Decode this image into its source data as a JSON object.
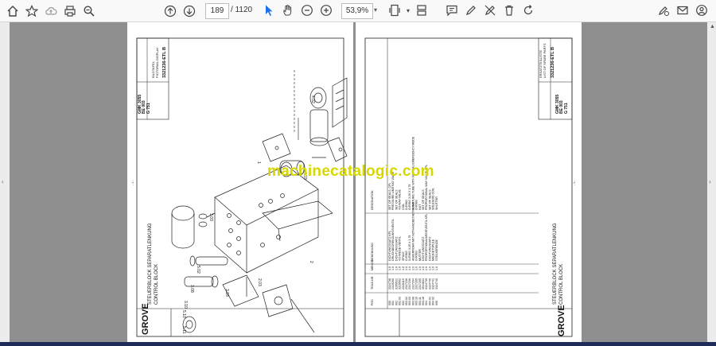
{
  "toolbar": {
    "page_current": "189",
    "page_total": "/ 1120",
    "zoom": "53,9%"
  },
  "watermark": "machinecatalogic.com",
  "left_page": {
    "brand": "GROVE",
    "title_de": "STEUERBLOCK SEPARATLENKUNG",
    "title_en": "CONTROL BLOCK",
    "model": "GMK 3055",
    "section": "BE 003",
    "sheet": "G 751",
    "drawing_no": "3321236-ETL B",
    "subtitle_de": "BILDTAFEL",
    "subtitle_en": "PICTORIAL DISPLAY",
    "page_marker": "- 1 -",
    "callouts": [
      "4.02",
      "4.03",
      "1",
      "3.03",
      "5.02",
      "3.08",
      "3.10",
      "5.10",
      "5.11",
      "3.18",
      "2.03",
      "2"
    ]
  },
  "right_page": {
    "brand": "GROVE",
    "title_de": "STEUERBLOCK SEPARATLENKUNG",
    "title_en": "CONTROL BLOCK",
    "model": "GMK 3055",
    "section": "BE 003",
    "sheet": "G 751",
    "drawing_no": "3321236-ETL B",
    "subtitle_de": "ERSATZTEILLISTE",
    "subtitle_en": "LIST OF SPARE PARTS",
    "page_marker": "- 1 -",
    "columns": [
      "POS",
      "TEILE-NR.",
      "MENGE",
      "BENENNUNG",
      "DESIGNATION"
    ],
    "rows": [
      {
        "pos": "000",
        "part": "3324738",
        "qty": "1.0",
        "de": "DICHTUNGSSATZ KPL",
        "en": "SET OF SEALS, CPL"
      },
      {
        "pos": "001",
        "part": "2319260",
        "qty": "1.0",
        "de": "DRUCKBEGRENZUNGSVENTIL",
        "en": "PRESSURE LIMITING VALVE"
      },
      {
        "pos": "002",
        "part": "3299521",
        "qty": "1.0",
        "de": "DICHTUNGSSATZ",
        "en": "SET OF SEALS"
      },
      {
        "pos": "002.03",
        "part": "3319502",
        "qty": "1.0",
        "de": "4/3-WEGE-VENTIL",
        "en": "4/3-WAY-VALVE"
      },
      {
        "pos": "003",
        "part": "2316119",
        "qty": "1.0",
        "de": "SPULE",
        "en": "COIL"
      },
      {
        "pos": "003.02",
        "part": "2317236",
        "qty": "1.0",
        "de": "O-RING",
        "en": "O-RING"
      },
      {
        "pos": "003.03",
        "part": "2317236",
        "qty": "1.0",
        "de": "O-RING 3,25 X 1,78",
        "en": "O-RING 3,25 X 1,78"
      },
      {
        "pos": "003.08",
        "part": "2317204",
        "qty": "1.0",
        "de": "ANKERROHR MIT NOTHANDBETAETIGUNG",
        "en": "ARMATURE TUBE WITH MANUAL EMERGENCY MODE"
      },
      {
        "pos": "003.10",
        "part": "2317205",
        "qty": "1.0",
        "de": "O-RING",
        "en": "O-RING"
      },
      {
        "pos": "003.11",
        "part": "2317205",
        "qty": "1.0",
        "de": "MUTTER",
        "en": "NUT"
      },
      {
        "pos": "003.18",
        "part": "3544831",
        "qty": "1.0",
        "de": "DICHTUNGSSATZ",
        "en": "SET OF SEALS"
      },
      {
        "pos": "004",
        "part": "3324739",
        "qty": "2.0",
        "de": "PROPORTIONALWEGEVENTIL KPL",
        "en": "PROPORTIONAL WAY VALVE CPL"
      },
      {
        "pos": "004.01",
        "part": "3324740",
        "qty": "1.0",
        "de": "DICHTUNGSSATZ",
        "en": "SET OF SEALS"
      },
      {
        "pos": "004.02",
        "part": "3324741",
        "qty": "1.0",
        "de": "MAGNETSPULE",
        "en": "SOLENOID COIL"
      },
      {
        "pos": "005",
        "part": "3324740",
        "qty": "1.0",
        "de": "STECKERENDE",
        "en": "SHUTTER"
      }
    ]
  }
}
